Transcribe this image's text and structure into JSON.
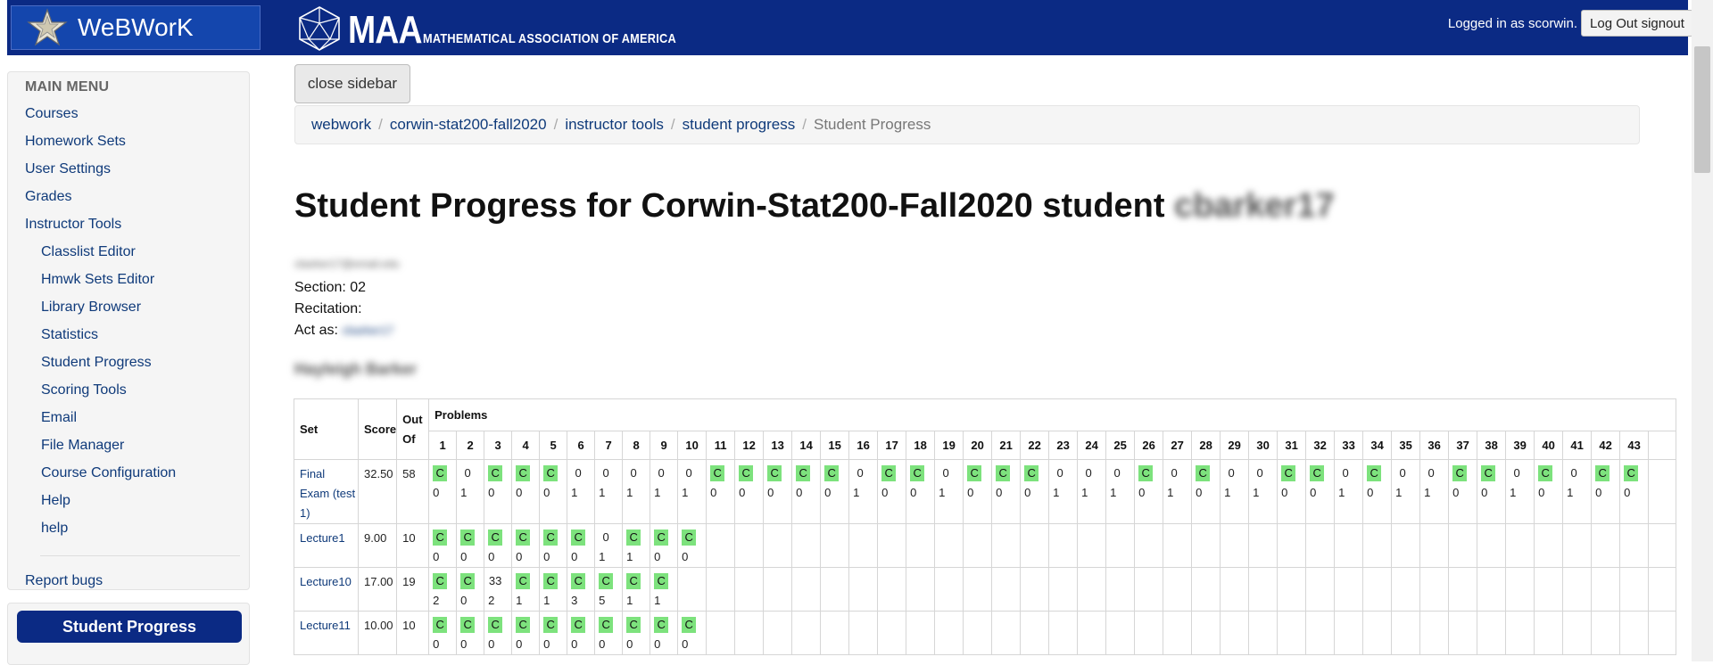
{
  "header": {
    "brand": "WeBWorK",
    "maa_big": "MAA",
    "maa_small": "MATHEMATICAL ASSOCIATION OF AMERICA",
    "login_text": "Logged in as scorwin.",
    "logout_label": "Log Out signout",
    "bar_color": "#0b2a84"
  },
  "sidebar": {
    "header": "MAIN MENU",
    "items": [
      {
        "label": "Courses"
      },
      {
        "label": "Homework Sets"
      },
      {
        "label": "User Settings"
      },
      {
        "label": "Grades"
      },
      {
        "label": "Instructor Tools"
      },
      {
        "label": "Classlist Editor"
      },
      {
        "label": "Hmwk Sets Editor"
      },
      {
        "label": "Library Browser"
      },
      {
        "label": "Statistics"
      },
      {
        "label": "Student Progress"
      },
      {
        "label": "Scoring Tools"
      },
      {
        "label": "Email"
      },
      {
        "label": "File Manager"
      },
      {
        "label": "Course Configuration"
      },
      {
        "label": "Help"
      },
      {
        "label": "help"
      }
    ],
    "report_bugs": "Report bugs",
    "student_progress_button": "Student Progress"
  },
  "main": {
    "close_sidebar": "close sidebar",
    "breadcrumb": [
      "webwork",
      "corwin-stat200-fall2020",
      "instructor tools",
      "student progress"
    ],
    "breadcrumb_current": "Student Progress",
    "title": "Student Progress for Corwin-Stat200-Fall2020 student",
    "redacted_username": "cbarker17",
    "redacted_email": "cbarker17@email.edu",
    "section": "Section: 02",
    "recitation": "Recitation:",
    "act_as_label": "Act as:",
    "redacted_act_as": "cbarker17",
    "redacted_name": "Hayleigh Barker"
  },
  "table": {
    "col_set": "Set",
    "col_score": "Score",
    "col_outof": "Out Of",
    "col_problems": "Problems",
    "problem_numbers": [
      "1",
      "2",
      "3",
      "4",
      "5",
      "6",
      "7",
      "8",
      "9",
      "10",
      "11",
      "12",
      "13",
      "14",
      "15",
      "16",
      "17",
      "18",
      "19",
      "20",
      "21",
      "22",
      "23",
      "24",
      "25",
      "26",
      "27",
      "28",
      "29",
      "30",
      "31",
      "32",
      "33",
      "34",
      "35",
      "36",
      "37",
      "38",
      "39",
      "40",
      "41",
      "42",
      "43"
    ],
    "rows": [
      {
        "set": "Final Exam (test 1)",
        "score": "32.50",
        "outof": "58",
        "status": [
          "C",
          "0",
          "C",
          "C",
          "C",
          "0",
          "0",
          "0",
          "0",
          "0",
          "C",
          "C",
          "C",
          "C",
          "C",
          "0",
          "C",
          "C",
          "0",
          "C",
          "C",
          "C",
          "0",
          "0",
          "0",
          "C",
          "0",
          "C",
          "0",
          "0",
          "C",
          "C",
          "0",
          "C",
          "0",
          "0",
          "C",
          "C",
          "0",
          "C",
          "0",
          "C",
          "C"
        ],
        "attempts": [
          "0",
          "1",
          "0",
          "0",
          "0",
          "1",
          "1",
          "1",
          "1",
          "1",
          "0",
          "0",
          "0",
          "0",
          "0",
          "1",
          "0",
          "0",
          "1",
          "0",
          "0",
          "0",
          "1",
          "1",
          "1",
          "0",
          "1",
          "0",
          "1",
          "1",
          "0",
          "0",
          "1",
          "0",
          "1",
          "1",
          "0",
          "0",
          "1",
          "0",
          "1",
          "0",
          "0"
        ]
      },
      {
        "set": "Lecture1",
        "score": "9.00",
        "outof": "10",
        "status": [
          "C",
          "C",
          "C",
          "C",
          "C",
          "C",
          "0",
          "C",
          "C",
          "C"
        ],
        "attempts": [
          "0",
          "0",
          "0",
          "0",
          "0",
          "0",
          "1",
          "1",
          "0",
          "0"
        ]
      },
      {
        "set": "Lecture10",
        "score": "17.00",
        "outof": "19",
        "status": [
          "C",
          "C",
          "33",
          "C",
          "C",
          "C",
          "C",
          "C",
          "C"
        ],
        "attempts": [
          "2",
          "0",
          "2",
          "1",
          "1",
          "3",
          "5",
          "1",
          "1"
        ]
      },
      {
        "set": "Lecture11",
        "score": "10.00",
        "outof": "10",
        "status": [
          "C",
          "C",
          "C",
          "C",
          "C",
          "C",
          "C",
          "C",
          "C",
          "C"
        ],
        "attempts": [
          "0",
          "0",
          "0",
          "0",
          "0",
          "0",
          "0",
          "0",
          "0",
          "0"
        ]
      }
    ],
    "correct_color": "#7de27d"
  }
}
